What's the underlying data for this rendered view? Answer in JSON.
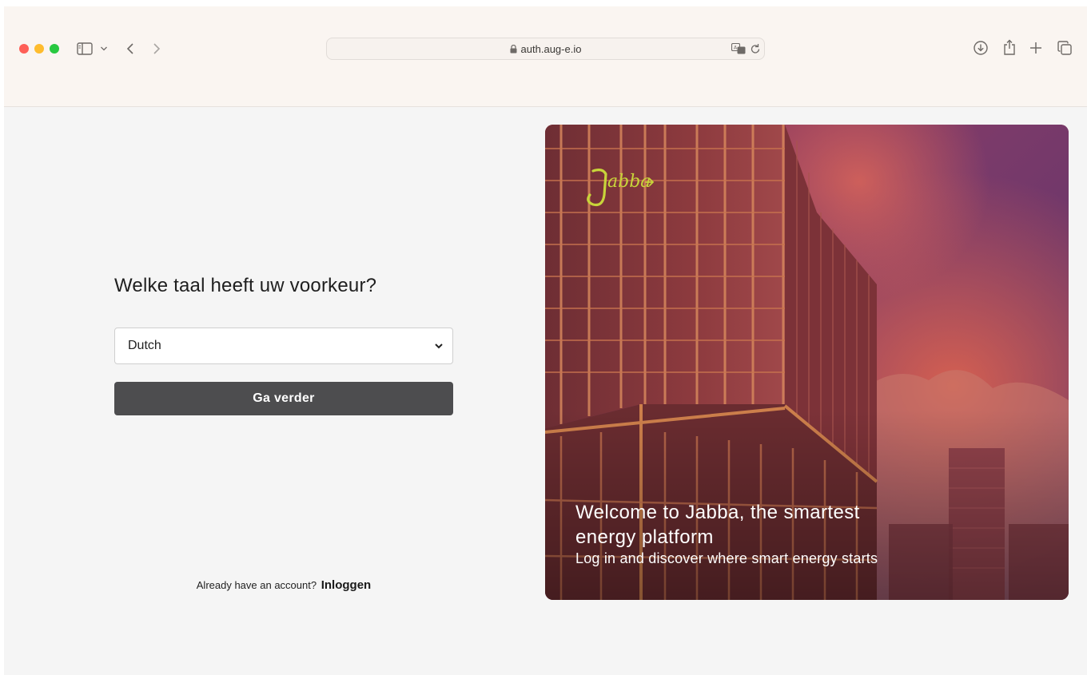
{
  "browser": {
    "url": "auth.aug-e.io"
  },
  "form": {
    "heading": "Welke taal heeft uw voorkeur?",
    "selected_language": "Dutch",
    "continue_label": "Ga verder",
    "footer_prompt": "Already have an account?",
    "login_label": "Inloggen"
  },
  "hero": {
    "logo_text": "Jabba",
    "title": "Welcome to Jabba, the smartest energy platform",
    "subtitle": "Log in and discover where smart energy starts"
  },
  "colors": {
    "toolbar_bg": "#faf5f1",
    "page_bg": "#f5f5f5",
    "button_bg": "#4d4d4f",
    "logo_accent": "#c8d43a"
  },
  "icons": {
    "traffic_lights": [
      "close",
      "minimize",
      "zoom"
    ],
    "toolbar_left": [
      "sidebar-icon",
      "chevron-down-icon",
      "back-arrow-icon",
      "forward-arrow-icon"
    ],
    "address_bar": [
      "lock-icon",
      "translate-icon",
      "reload-icon"
    ],
    "toolbar_right": [
      "download-icon",
      "share-icon",
      "plus-icon",
      "tabs-overview-icon"
    ]
  }
}
